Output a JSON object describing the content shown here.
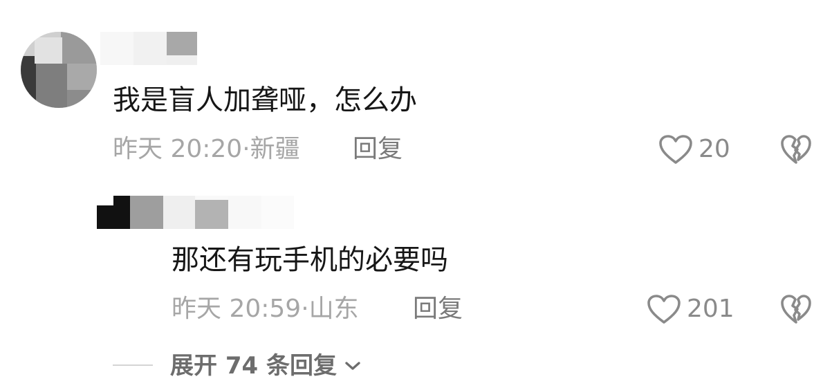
{
  "comments": [
    {
      "text": "我是盲人加聋哑，怎么办",
      "time": "昨天 20:20",
      "sep": "·",
      "location": "新疆",
      "reply_label": "回复",
      "likes": "20"
    },
    {
      "text": "那还有玩手机的必要吗",
      "time": "昨天 20:59",
      "sep": "·",
      "location": "山东",
      "reply_label": "回复",
      "likes": "201"
    }
  ],
  "expand_label": "展开 74 条回复",
  "icons": {
    "like": "heart-outline-icon",
    "dislike": "broken-heart-icon",
    "expand": "chevron-down-icon"
  }
}
